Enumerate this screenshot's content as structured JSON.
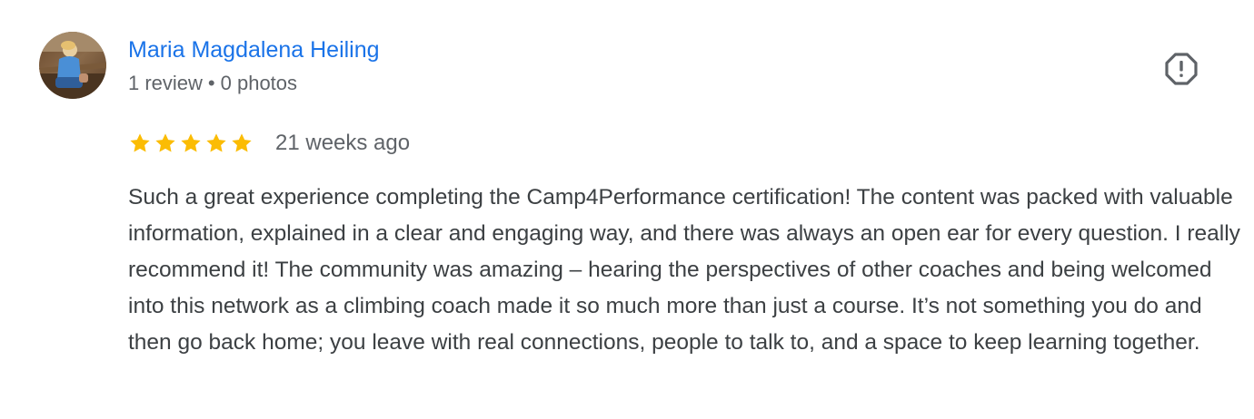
{
  "review": {
    "author": {
      "name": "Maria Magdalena Heiling",
      "review_count": "1 review",
      "separator": "•",
      "photo_count": "0 photos",
      "avatar_icon": "user-photo-avatar"
    },
    "rating": {
      "stars": 5,
      "max_stars": 5,
      "star_color": "#fbbc04",
      "star_icon": "star-icon"
    },
    "time_ago": "21 weeks ago",
    "text": "Such a great experience completing the Camp4Performance certification! The content was packed with valuable information, explained in a clear and engaging way, and there was always an open ear for every question. I really recommend it! The community was amazing – hearing the perspectives of other coaches and being welcomed into this network as a climbing coach made it so much more than just a course. It’s not something you do and then go back home; you leave with real connections, people to talk to, and a space to keep learning together.",
    "flag_icon": "report-octagon-icon"
  },
  "colors": {
    "link": "#1a73e8",
    "secondary_text": "#5f6368",
    "body_text": "#3c4043",
    "icon": "#5f6368"
  }
}
